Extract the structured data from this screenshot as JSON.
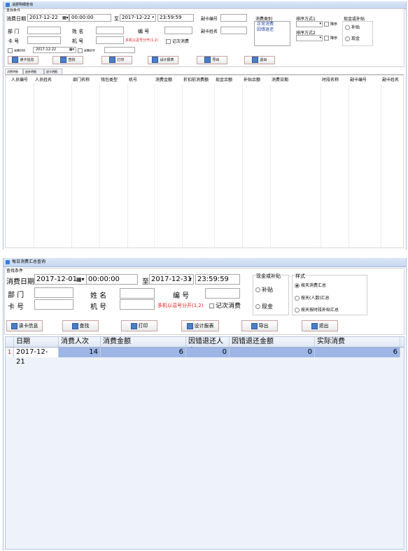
{
  "window1": {
    "title": "消费明细查询",
    "group_label": "查找条件",
    "date_label": "消费日期",
    "date_from": "2017-12-22",
    "time_from": "00:00:00",
    "to_label": "至",
    "date_to": "2017-12-22",
    "time_to": "23:59:59",
    "card_no_label": "副卡编号",
    "card_name_label": "副卡姓名",
    "dept_label": "部 门",
    "card_label": "卡 号",
    "name_label": "姓 名",
    "no_label": "编 号",
    "machine_label": "机 号",
    "machine_hint": "多机以逗号分开(1,2)",
    "record_times_label": "记次消费",
    "type_label": "消费类别",
    "type_options": [
      "正常消费",
      "因错退还"
    ],
    "sort1_label": "排序方式1",
    "sort2_label": "排序方式2",
    "desc_label": "降序",
    "cash_label": "现金或补贴",
    "cash_options": [
      "补贴",
      "现金"
    ],
    "collect_time_label": "采集时间",
    "collect_date": "2017-12-22",
    "collect_machine_label": "采集机号",
    "buttons": [
      "读卡信息",
      "查找",
      "打印",
      "设计报表",
      "导出",
      "退出"
    ],
    "tabs": [
      "消费明细",
      "退补明细",
      "退卡明细"
    ],
    "columns": [
      "人员编号",
      "人员姓名",
      "部门名称",
      "钱包类型",
      "机号",
      "消费金额",
      "折扣前消费额",
      "现金余额",
      "补贴余额",
      "消费日期",
      "时段名称",
      "副卡编号",
      "副卡姓名"
    ]
  },
  "window2": {
    "title": "每日消费汇总查询",
    "group_label": "查找条件",
    "date_label": "消费日期",
    "date_from": "2017-12-01",
    "time_from": "00:00:00",
    "to_label": "至",
    "date_to": "2017-12-31",
    "time_to": "23:59:59",
    "dept_label": "部 门",
    "card_label": "卡 号",
    "name_label": "姓 名",
    "machine_label": "机 号",
    "no_label": "编 号",
    "machine_hint": "多机以逗号分开(1,2)",
    "record_times_label": "记次消费",
    "cash_label": "现金或补贴",
    "cash_options": [
      "补贴",
      "现金"
    ],
    "style_label": "样式",
    "style_options": [
      "按天消费汇总",
      "按天(人数)汇总",
      "按天按时段补贴汇总"
    ],
    "buttons": [
      "读卡信息",
      "查找",
      "打印",
      "设计报表",
      "导出",
      "退出"
    ],
    "columns": [
      "日期",
      "消费人次",
      "消费金额",
      "因错退还人次",
      "因错退还金额",
      "实际消费"
    ],
    "rows": [
      {
        "index": "1",
        "date": "2017-12-21",
        "count": "14",
        "amount": "6",
        "refund_count": "0",
        "refund_amount": "0",
        "actual": "6"
      }
    ]
  }
}
